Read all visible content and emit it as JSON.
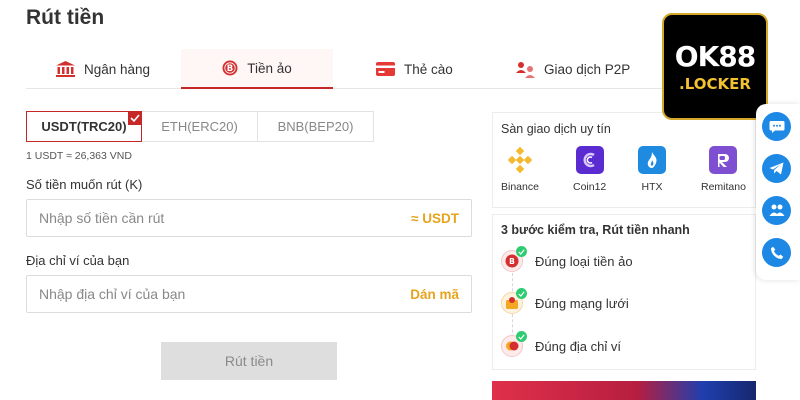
{
  "page": {
    "title": "Rút tiền"
  },
  "tabs": [
    {
      "label": "Ngân hàng",
      "icon": "bank-icon"
    },
    {
      "label": "Tiền ảo",
      "icon": "crypto-coin-icon",
      "active": true
    },
    {
      "label": "Thẻ cào",
      "icon": "card-icon"
    },
    {
      "label": "Giao dịch P2P",
      "icon": "p2p-users-icon"
    }
  ],
  "coins": [
    {
      "label": "USDT(TRC20)",
      "selected": true
    },
    {
      "label": "ETH(ERC20)"
    },
    {
      "label": "BNB(BEP20)"
    }
  ],
  "rate": "1 USDT ≈ 26,363 VND",
  "amount": {
    "label": "Số tiền muốn rút (K)",
    "placeholder": "Nhập số tiền cần rút",
    "suffix": "≈ USDT"
  },
  "address": {
    "label": "Địa chỉ ví của bạn",
    "placeholder": "Nhập địa chỉ ví của bạn",
    "paste": "Dán mã"
  },
  "submit": "Rút tiền",
  "exchanges": {
    "title": "Sàn giao dịch uy tín",
    "items": [
      {
        "name": "Binance",
        "icon": "binance-logo-icon",
        "color": "#F3BA2F"
      },
      {
        "name": "Coin12",
        "icon": "coin12-logo-icon",
        "color": "#5A2BD1"
      },
      {
        "name": "HTX",
        "icon": "htx-logo-icon",
        "color": "#1E8BE0"
      },
      {
        "name": "Remitano",
        "icon": "remitano-logo-icon",
        "color": "#7E4FD1"
      }
    ]
  },
  "steps": {
    "title": "3 bước kiểm tra, Rút tiền nhanh",
    "items": [
      {
        "text": "Đúng loại tiền ảo",
        "icon": "crypto-check-icon"
      },
      {
        "text": "Đúng mạng lưới",
        "icon": "network-check-icon"
      },
      {
        "text": "Đúng địa chỉ ví",
        "icon": "wallet-check-icon"
      }
    ]
  },
  "brand": {
    "line1": "OK88",
    "line2": ".LOCKER"
  },
  "float_buttons": [
    "chat-icon",
    "telegram-icon",
    "support-icon",
    "phone-icon"
  ],
  "colors": {
    "accent": "#C62828",
    "gold": "#E6A41E",
    "float_blue": "#1E88E5"
  }
}
